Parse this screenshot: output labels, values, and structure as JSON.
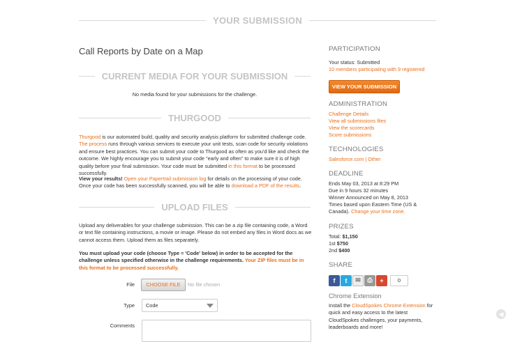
{
  "header": {
    "section_title": "YOUR SUBMISSION"
  },
  "challenge_title": "Call Reports by Date on a Map",
  "media": {
    "title": "CURRENT MEDIA FOR YOUR SUBMISSION",
    "empty_text": "No media found for your submissions for the challenge."
  },
  "thurgood": {
    "title": "THURGOOD",
    "p1": {
      "link1": "Thurgood",
      "text1": " is our automated build, quality and security analysis platform for submitted challenge code.",
      "link2": "The process",
      "text2": " runs through various services to execute your unit tests, scan code for security violations and ensure best practices. You can submit your code to Thurgood as often as you'd like and check the outcome. We highly encourage you to submit your code \"early and often\" to make sure it is of high quality before your final submission. Your code must be submitted ",
      "link3": "in this format",
      "text3": " to be processed successfully."
    },
    "p2": {
      "bold": "View your results!",
      "link1": " Open your Papertrail submission log",
      "text1": " for details on the processing of your code. Once your code has been successfully scanned, you will be able to ",
      "link2": "download a PDF of the results",
      "text2": "."
    }
  },
  "upload": {
    "title": "UPLOAD FILES",
    "intro": "Upload any deliverables for your challenge submission. This can be a zip file containing code, a Word or text file containing instructions, a movie or image. Please do not embed any files in Word docs as we cannot access them. Upload them as files separately.",
    "warning_bold": "You must upload your code (choose Type = 'Code' below) in order to be accepted for the challenge unless specified otherwise in the challenge requirements.",
    "warning_link": " Your ZIP files must be in this format to be processed successfully.",
    "file_label": "File",
    "choose_file": "CHOOSE FILE",
    "no_file": "No file chosen",
    "type_label": "Type",
    "type_value": "Code",
    "comments_label": "Comments"
  },
  "sidebar": {
    "participation": {
      "title": "PARTICIPATION",
      "status": "Your status: Submitted",
      "members_link": "10 members participating with 9 registered",
      "button": "VIEW YOUR SUBMISSION"
    },
    "administration": {
      "title": "ADMINISTRATION",
      "links": [
        "Challenge Details",
        "View all submissions files",
        "View the scorecards",
        "Score submissions"
      ]
    },
    "technologies": {
      "title": "TECHNOLOGIES",
      "items": [
        "Salesforce.com",
        "Other"
      ],
      "separator": " | "
    },
    "deadline": {
      "title": "DEADLINE",
      "ends": "Ends May 03, 2013 at 8:29 PM",
      "due": "Due in 9 hours 32 minutes",
      "winner": "Winner Announced on May 8, 2013",
      "timezone_text": "Times based upon Eastern Time (US & Canada).",
      "timezone_link": "Change your time zone."
    },
    "prizes": {
      "title": "PRIZES",
      "items": [
        {
          "label": "Total: ",
          "value": "$1,150"
        },
        {
          "label": "1st ",
          "value": "$750"
        },
        {
          "label": "2nd ",
          "value": "$400"
        }
      ]
    },
    "share": {
      "title": "SHARE",
      "count": "0",
      "colors": {
        "facebook": "#3b5998",
        "twitter": "#2aa9e0",
        "plus": "#d6492f"
      }
    },
    "chrome": {
      "title": "Chrome Extension",
      "text1": "Install the ",
      "link": "CloudSpokes Chrome Extension",
      "text2": " for quick and easy access to the latest CloudSpokes challenges, your payments, leaderboards and more!"
    }
  },
  "colors": {
    "accent": "#e86f1a",
    "divider": "#d8d8d8",
    "muted_heading": "#c4c4c4"
  }
}
